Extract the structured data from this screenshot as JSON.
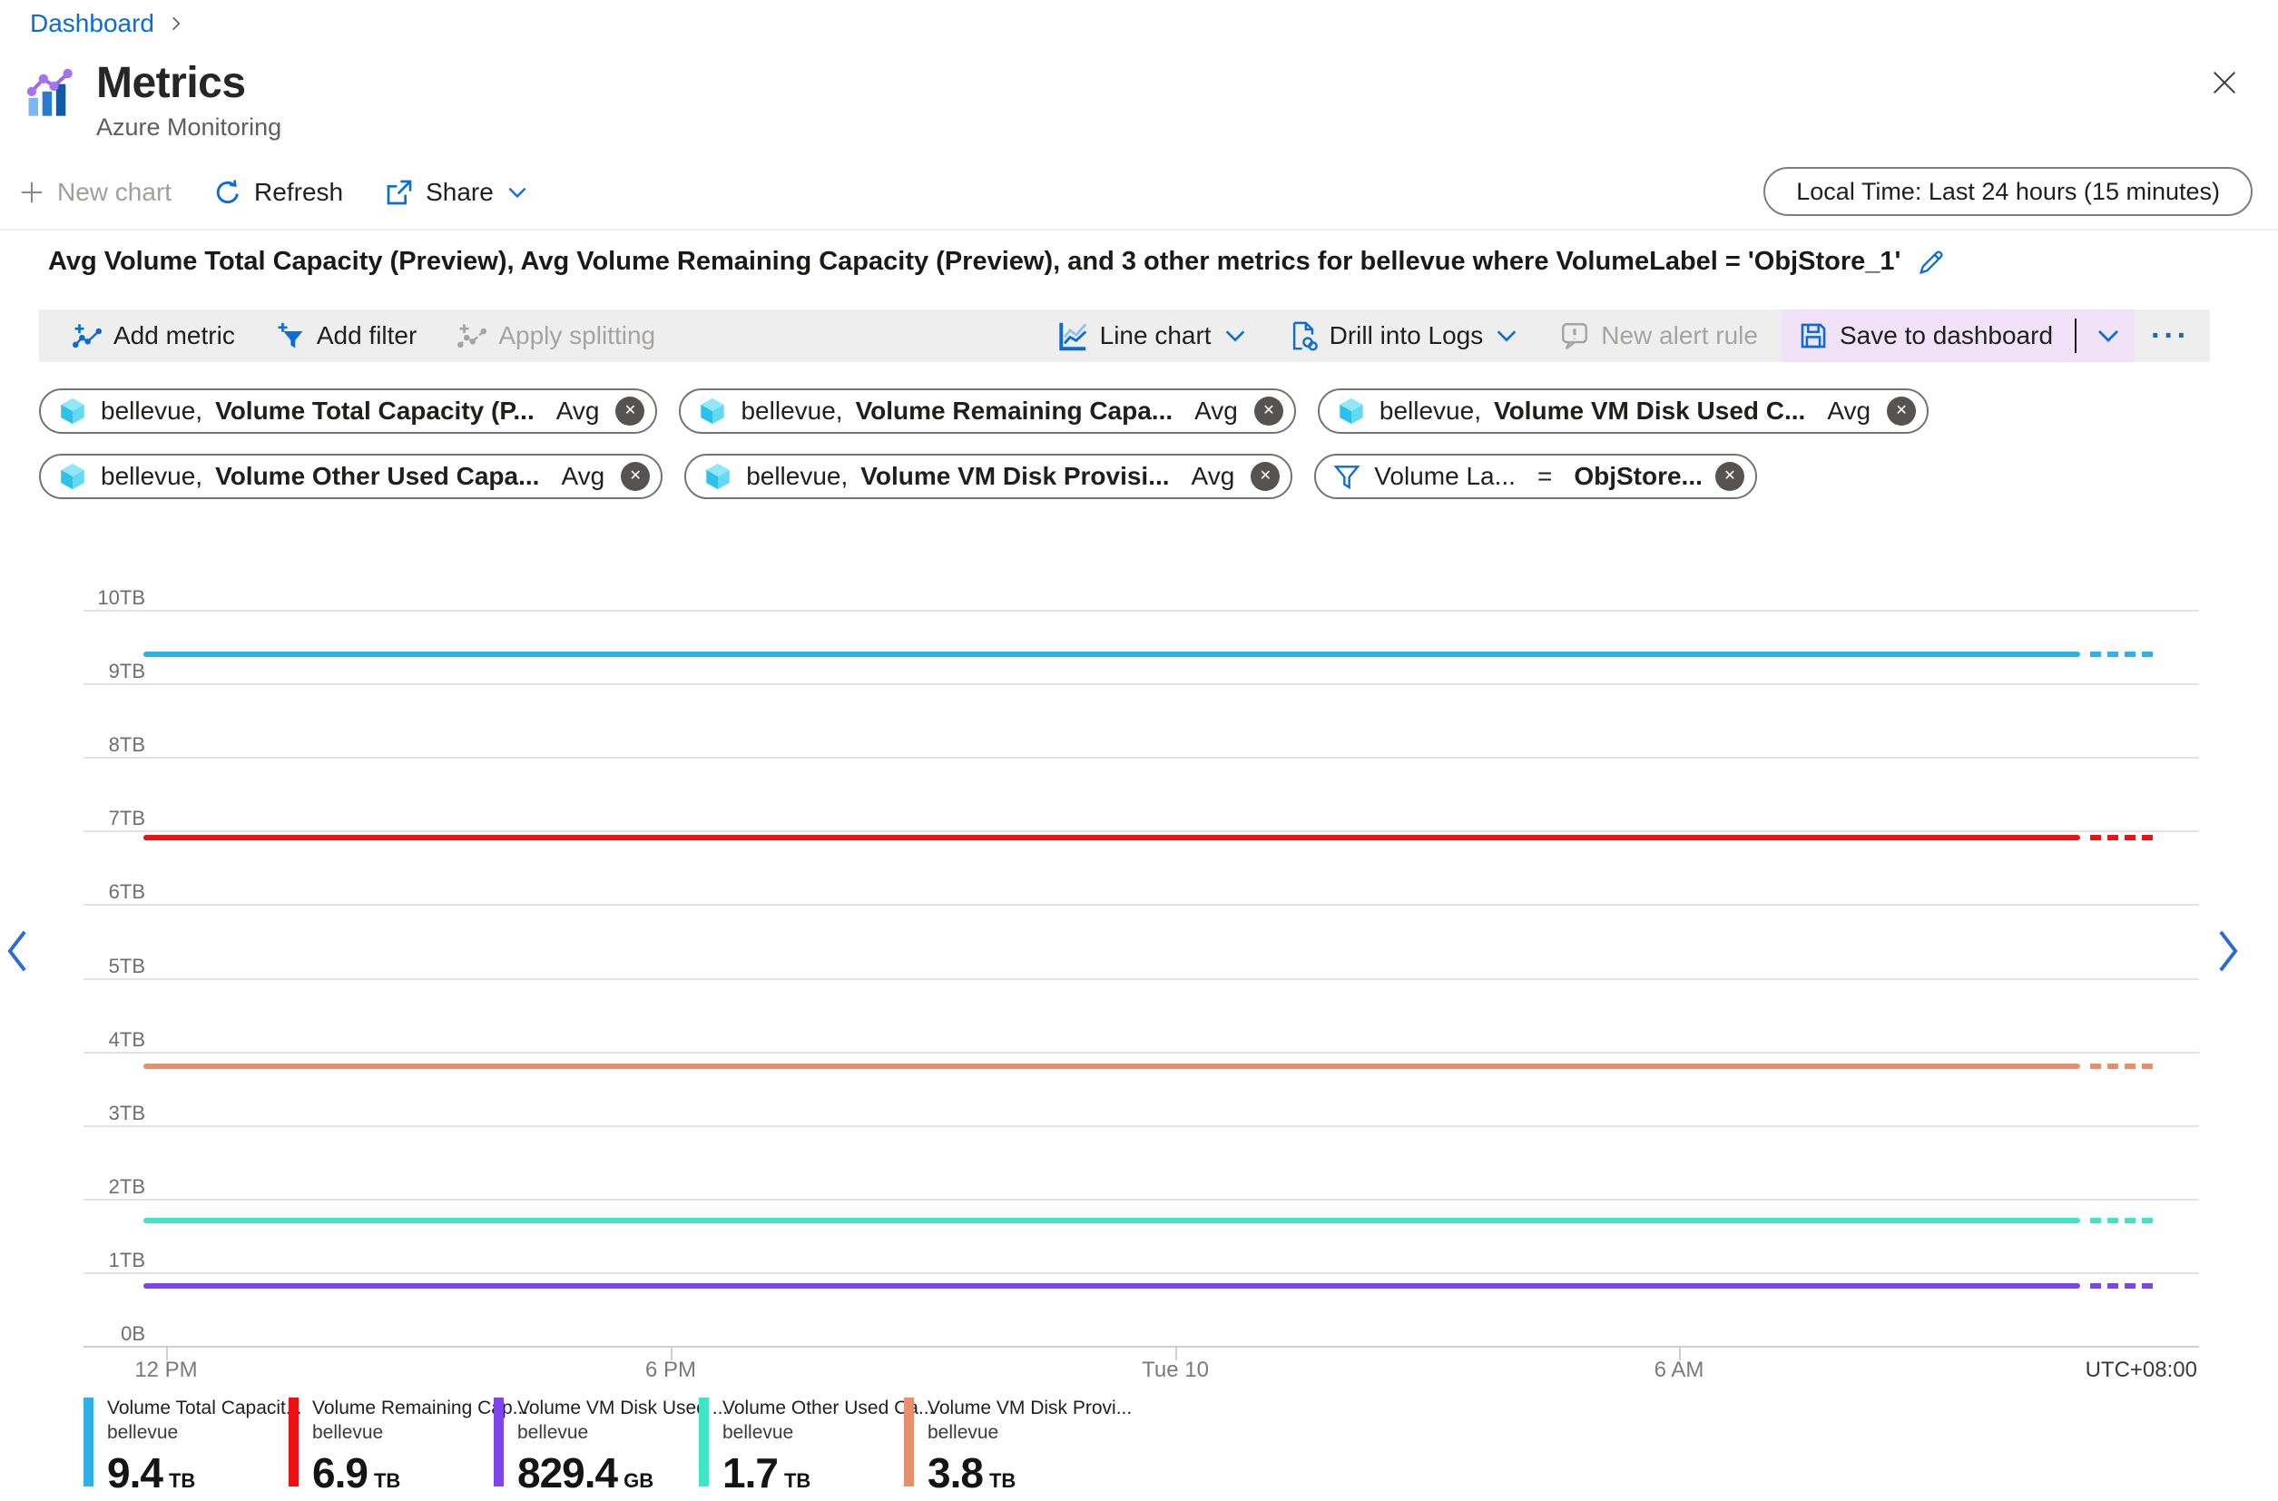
{
  "breadcrumb": {
    "dashboard": "Dashboard"
  },
  "header": {
    "title": "Metrics",
    "subtitle": "Azure Monitoring"
  },
  "toolbar": {
    "new_chart": "New chart",
    "refresh": "Refresh",
    "share": "Share",
    "time_range": "Local Time: Last 24 hours (15 minutes)"
  },
  "chart_header": {
    "title": "Avg Volume Total Capacity (Preview), Avg Volume Remaining Capacity (Preview), and 3 other metrics for bellevue where VolumeLabel = 'ObjStore_1'"
  },
  "command_bar": {
    "add_metric": "Add metric",
    "add_filter": "Add filter",
    "apply_splitting": "Apply splitting",
    "line_chart": "Line chart",
    "drill_into_logs": "Drill into Logs",
    "new_alert_rule": "New alert rule",
    "save_to_dashboard": "Save to dashboard",
    "more": "···"
  },
  "pills": [
    {
      "scope": "bellevue,",
      "metric": "Volume Total Capacity (P...",
      "agg": "Avg"
    },
    {
      "scope": "bellevue,",
      "metric": "Volume Remaining Capa...",
      "agg": "Avg"
    },
    {
      "scope": "bellevue,",
      "metric": "Volume VM Disk Used C...",
      "agg": "Avg"
    },
    {
      "scope": "bellevue,",
      "metric": "Volume Other Used Capa...",
      "agg": "Avg"
    },
    {
      "scope": "bellevue,",
      "metric": "Volume VM Disk Provisi...",
      "agg": "Avg"
    }
  ],
  "filter_pill": {
    "field": "Volume La...",
    "op": "=",
    "value": "ObjStore..."
  },
  "chart_data": {
    "type": "line",
    "title": "Avg Volume Total Capacity (Preview), Avg Volume Remaining Capacity (Preview), and 3 other metrics for bellevue where VolumeLabel = 'ObjStore_1'",
    "x_ticks": [
      "12 PM",
      "6 PM",
      "Tue 10",
      "6 AM"
    ],
    "y_ticks": [
      "10TB",
      "9TB",
      "8TB",
      "7TB",
      "6TB",
      "5TB",
      "4TB",
      "3TB",
      "2TB",
      "1TB",
      "0B"
    ],
    "ylim_tb": [
      0,
      10
    ],
    "grid": true,
    "timezone": "UTC+08:00",
    "legend_position": "bottom",
    "series": [
      {
        "name": "Volume Total Capacit...",
        "resource": "bellevue",
        "value": "9.4",
        "unit": "TB",
        "value_tb": 9.4,
        "color": "#2fb0e8"
      },
      {
        "name": "Volume Remaining Cap...",
        "resource": "bellevue",
        "value": "6.9",
        "unit": "TB",
        "value_tb": 6.9,
        "color": "#ee1111"
      },
      {
        "name": "Volume VM Disk Used ...",
        "resource": "bellevue",
        "value": "829.4",
        "unit": "GB",
        "value_tb": 0.81,
        "color": "#7e46e8"
      },
      {
        "name": "Volume Other Used Ca...",
        "resource": "bellevue",
        "value": "1.7",
        "unit": "TB",
        "value_tb": 1.7,
        "color": "#3fe4c5"
      },
      {
        "name": "Volume VM Disk Provi...",
        "resource": "bellevue",
        "value": "3.8",
        "unit": "TB",
        "value_tb": 3.8,
        "color": "#e8906e"
      }
    ]
  }
}
